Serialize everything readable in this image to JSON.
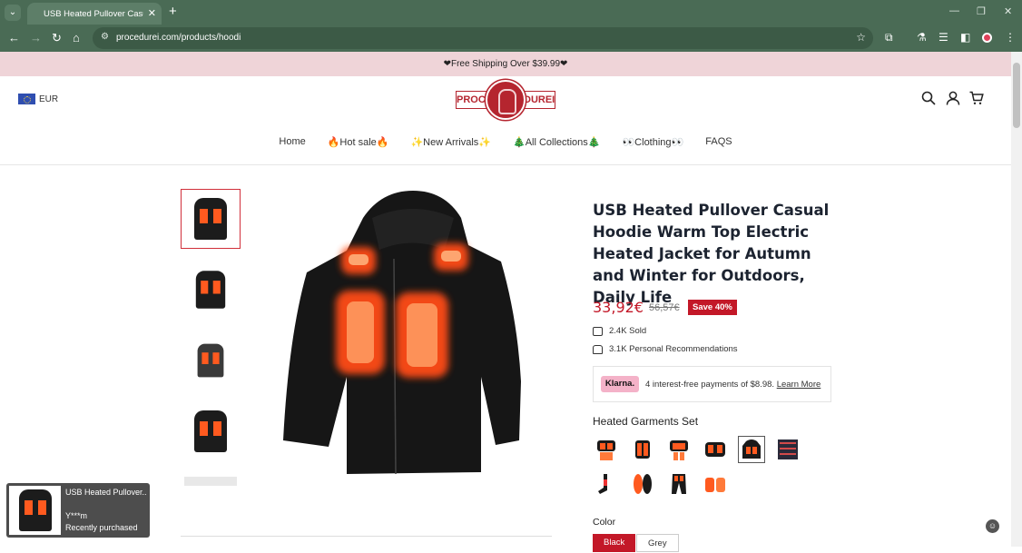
{
  "browser": {
    "tab_title": "USB Heated Pullover Casual Hoodie",
    "url": "procedurei.com/products/hoodi",
    "icons": [
      "tab-menu-icon",
      "close-icon",
      "plus-icon",
      "back-icon",
      "forward-icon",
      "reload-icon",
      "home-icon",
      "site-info-icon",
      "star-icon",
      "extensions-icon",
      "labs-icon",
      "reading-list-icon",
      "side-panel-icon",
      "profile-icon",
      "more-icon",
      "minimize-icon",
      "restore-icon",
      "window-close-icon"
    ]
  },
  "promo": {
    "text": "❤Free Shipping Over $39.99❤"
  },
  "header": {
    "currency": "EUR",
    "logo_left": "PROCE",
    "logo_right": "DUREI",
    "icons": [
      "search-icon",
      "account-icon",
      "cart-icon"
    ]
  },
  "nav": {
    "items": [
      "Home",
      "🔥Hot sale🔥",
      "✨New Arrivals✨",
      "🎄All Collections🎄",
      "👀Clothing👀",
      "FAQS"
    ]
  },
  "product": {
    "title": "USB Heated Pullover Casual Hoodie Warm Top Electric Heated Jacket for Autumn and Winter for Outdoors, Daily Life",
    "price": "33,92€",
    "compare_price": "56,57€",
    "save_badge": "Save 40%",
    "sold": "2.4K Sold",
    "recommendations": "3.1K Personal Recommendations",
    "klarna_badge": "Klarna.",
    "klarna_text": "4 interest-free payments of $8.98.",
    "klarna_link": "Learn More",
    "set_label": "Heated Garments Set",
    "color_label": "Color",
    "colors": [
      "Black",
      "Grey"
    ]
  },
  "popup": {
    "title": "USB Heated Pullover...",
    "user": "Y***m",
    "subtitle": "Recently purchased"
  },
  "colors": {
    "brand": "#b5252f",
    "price": "#c31828",
    "promo_bg": "#efd4d8",
    "chrome": "#4a6b55"
  }
}
